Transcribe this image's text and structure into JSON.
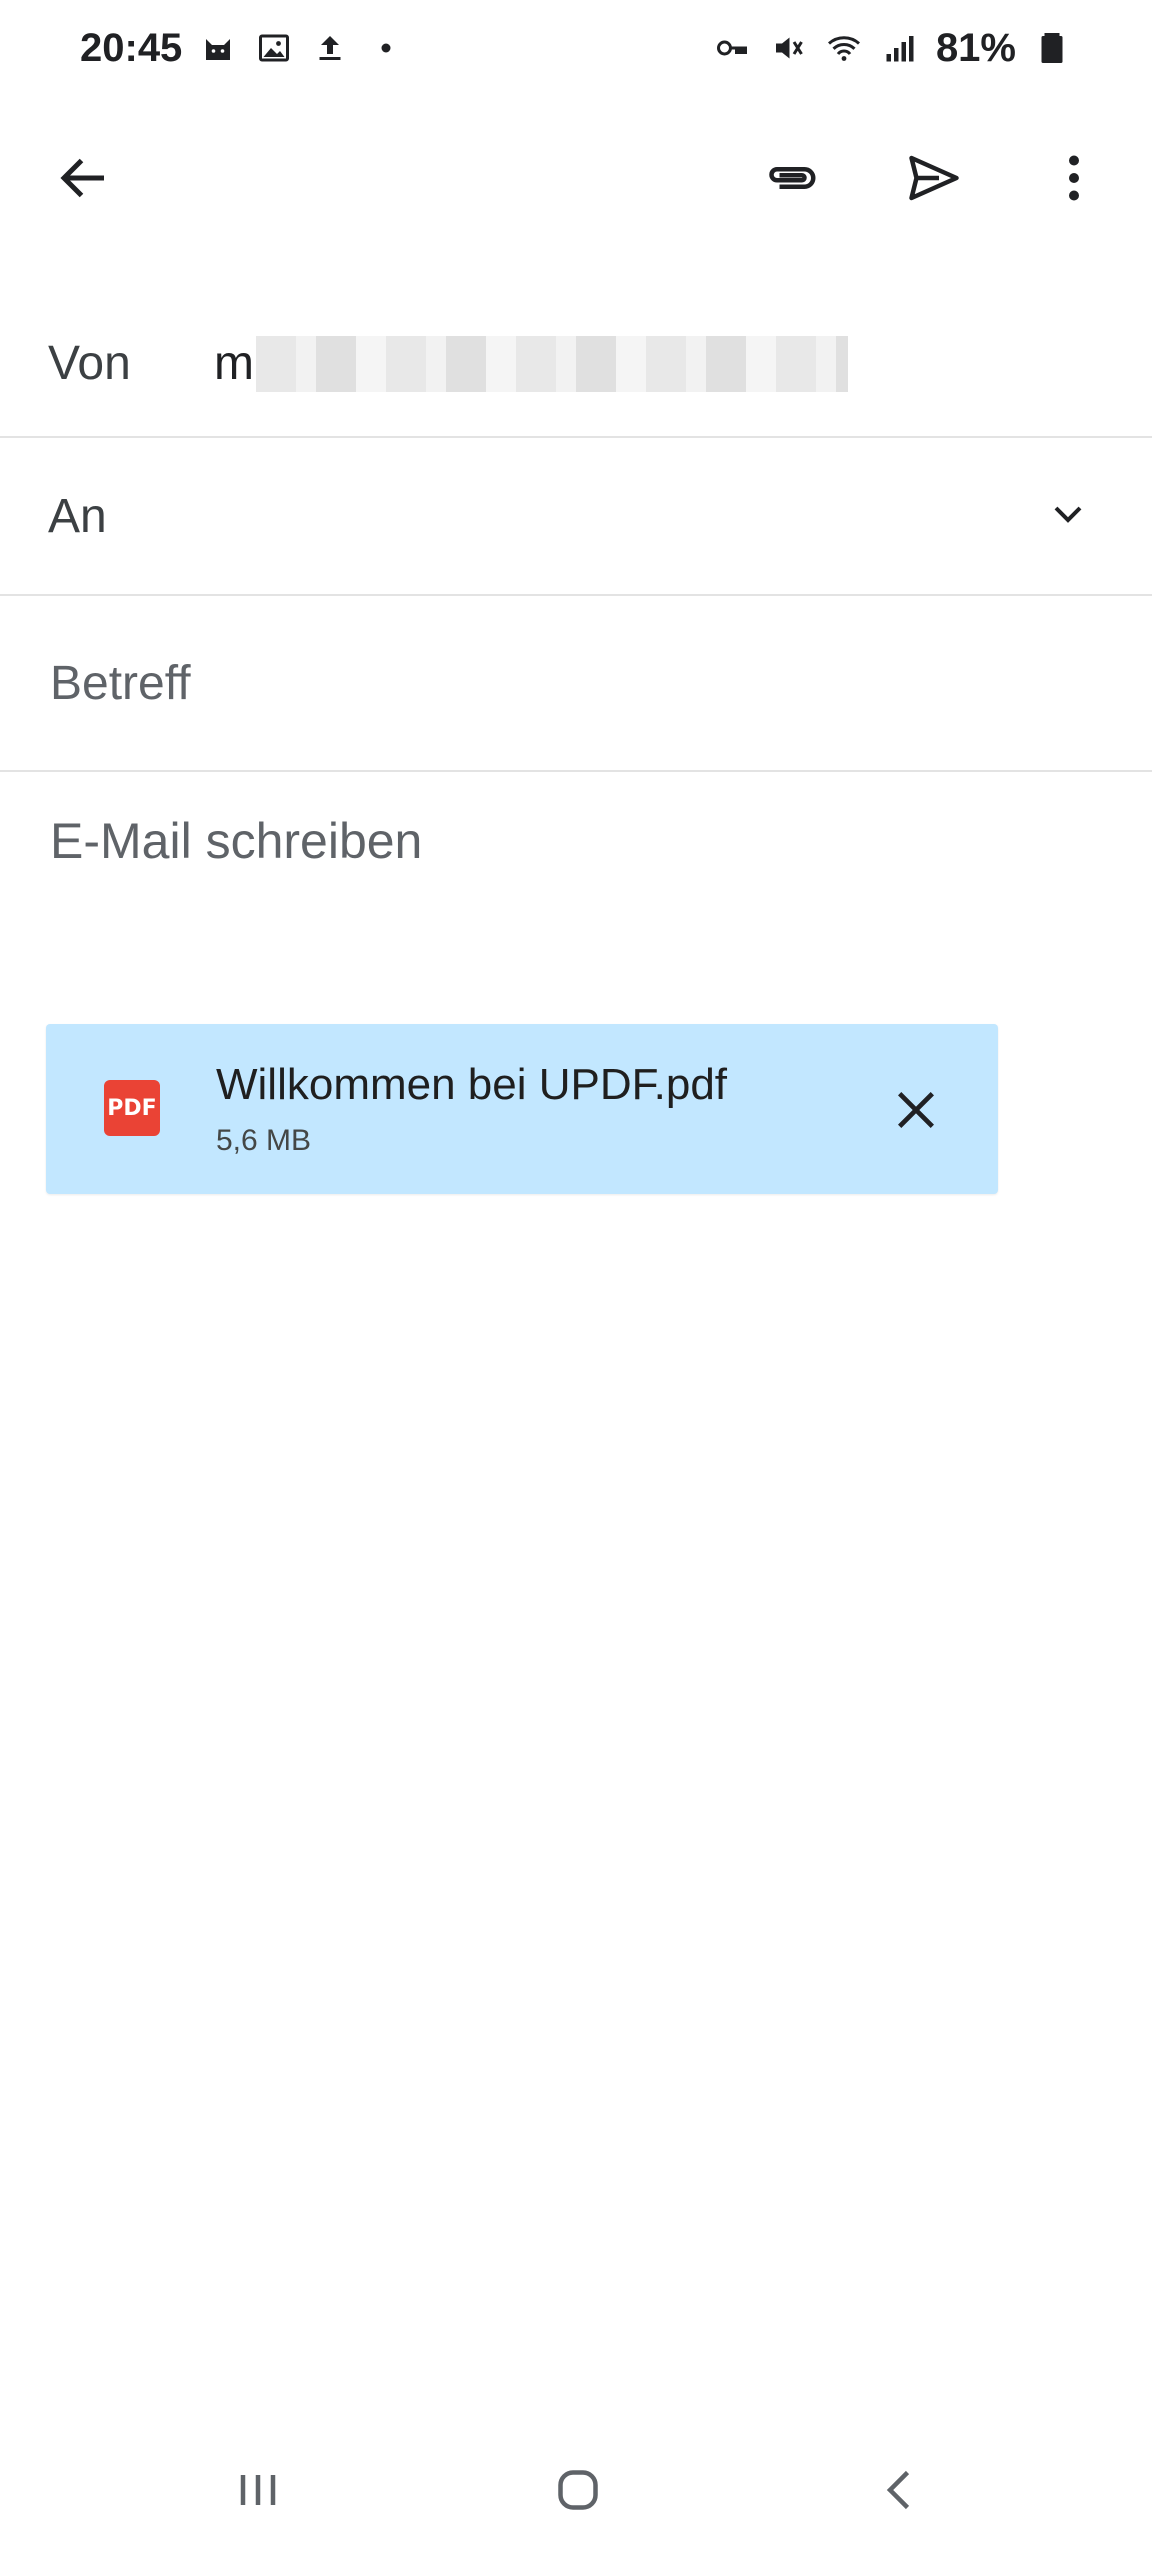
{
  "status_bar": {
    "time": "20:45",
    "battery": "81%",
    "left_icons": [
      "cat-icon",
      "image-icon",
      "upload-icon",
      "dot-icon"
    ],
    "right_icons": [
      "vpn-key-icon",
      "mute-icon",
      "wifi-icon",
      "signal-icon",
      "battery-icon"
    ]
  },
  "toolbar": {
    "icons": [
      "back-arrow-icon",
      "paperclip-icon",
      "send-icon",
      "more-vert-icon"
    ]
  },
  "compose": {
    "from_label": "Von",
    "from_value_prefix": "m",
    "to_label": "An",
    "to_value": "",
    "subject_placeholder": "Betreff",
    "body_placeholder": "E-Mail schreiben"
  },
  "attachment": {
    "type_label": "PDF",
    "name": "Willkommen bei UPDF.pdf",
    "size": "5,6 MB"
  },
  "colors": {
    "attachment_bg": "#c2e7ff",
    "pdf_red": "#ea4335",
    "divider": "#e3e3e3"
  }
}
